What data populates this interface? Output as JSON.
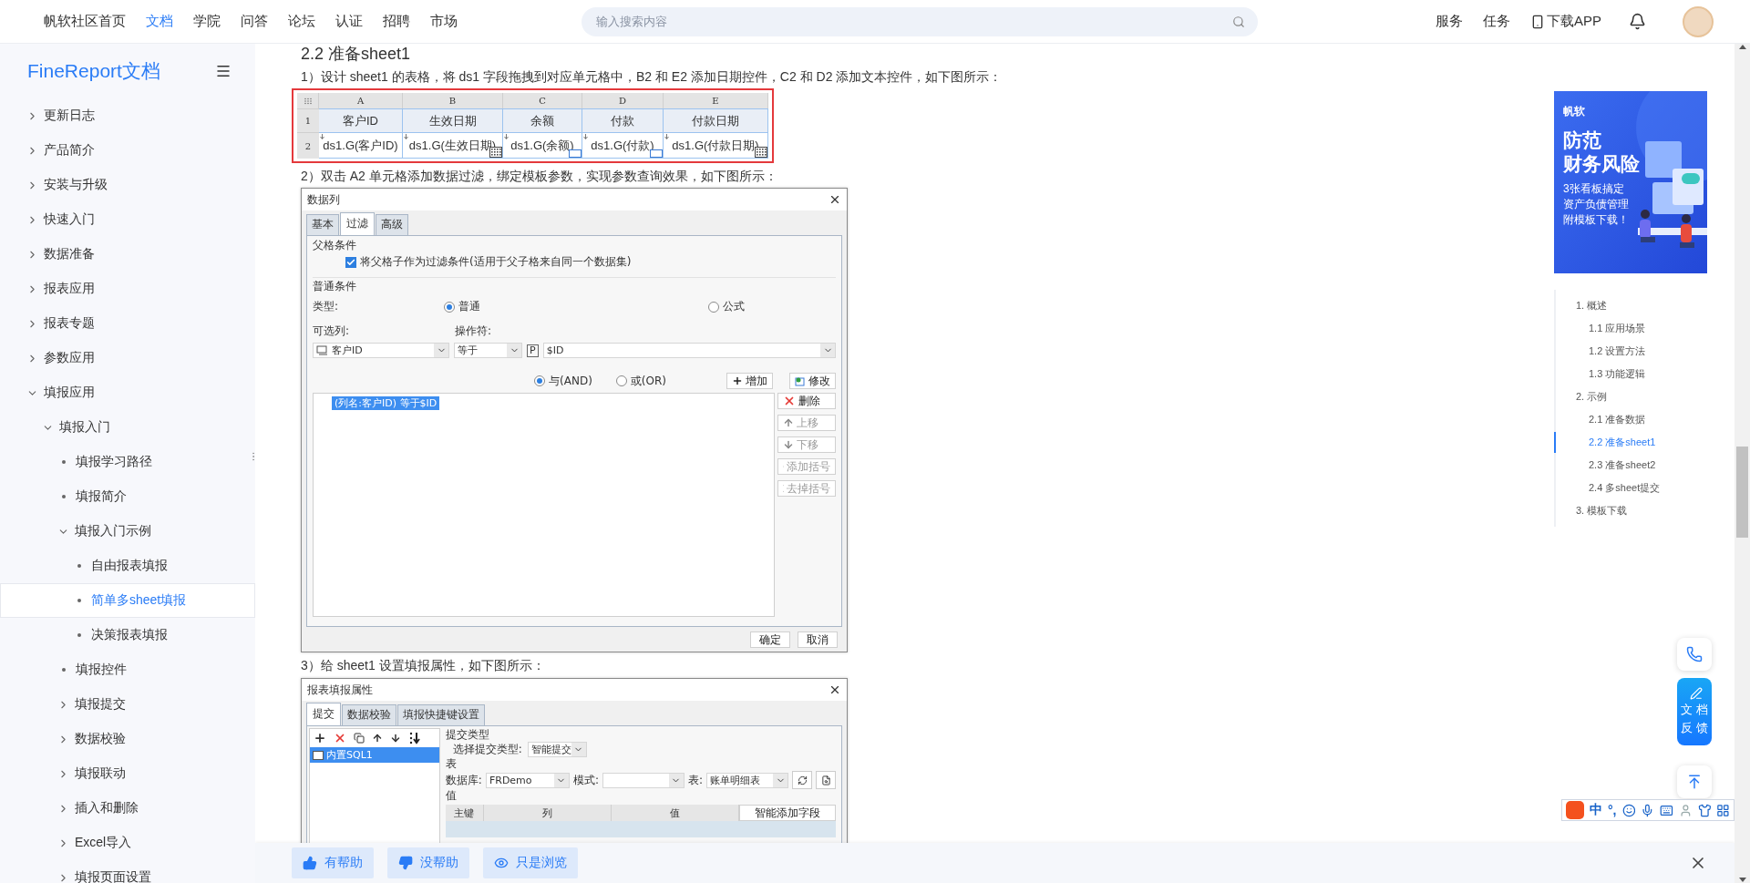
{
  "top_nav": {
    "items": [
      {
        "label": "帆软社区首页",
        "selected": false
      },
      {
        "label": "文档",
        "selected": true
      },
      {
        "label": "学院",
        "selected": false
      },
      {
        "label": "问答",
        "selected": false
      },
      {
        "label": "论坛",
        "selected": false
      },
      {
        "label": "认证",
        "selected": false
      },
      {
        "label": "招聘",
        "selected": false
      },
      {
        "label": "市场",
        "selected": false
      }
    ],
    "search": {
      "placeholder": "输入搜索内容"
    },
    "links": [
      "服务",
      "任务"
    ],
    "download": "下载APP"
  },
  "sidebar": {
    "title": "FineReport文档",
    "items": [
      {
        "label": "更新日志",
        "kind": "folder",
        "expanded": false,
        "selected": false
      },
      {
        "label": "产品简介",
        "kind": "folder",
        "expanded": false,
        "selected": false
      },
      {
        "label": "安装与升级",
        "kind": "folder",
        "expanded": false,
        "selected": false
      },
      {
        "label": "快速入门",
        "kind": "folder",
        "expanded": false,
        "selected": false
      },
      {
        "label": "数据准备",
        "kind": "folder",
        "expanded": false,
        "selected": false
      },
      {
        "label": "报表应用",
        "kind": "folder",
        "expanded": false,
        "selected": false
      },
      {
        "label": "报表专题",
        "kind": "folder",
        "expanded": false,
        "selected": false
      },
      {
        "label": "参数应用",
        "kind": "folder",
        "expanded": false,
        "selected": false
      },
      {
        "label": "填报应用",
        "kind": "folder",
        "expanded": true,
        "selected": false,
        "children": [
          {
            "label": "填报入门",
            "kind": "folder",
            "expanded": true,
            "selected": false,
            "children": [
              {
                "label": "填报学习路径",
                "kind": "page",
                "selected": false
              },
              {
                "label": "填报简介",
                "kind": "page",
                "selected": false
              },
              {
                "label": "填报入门示例",
                "kind": "folder",
                "expanded": true,
                "selected": false,
                "children": [
                  {
                    "label": "自由报表填报",
                    "kind": "page",
                    "selected": false
                  },
                  {
                    "label": "简单多sheet填报",
                    "kind": "page",
                    "selected": true
                  },
                  {
                    "label": "决策报表填报",
                    "kind": "page",
                    "selected": false
                  }
                ]
              },
              {
                "label": "填报控件",
                "kind": "page",
                "selected": false
              },
              {
                "label": "填报提交",
                "kind": "folder",
                "expanded": false,
                "selected": false
              },
              {
                "label": "数据校验",
                "kind": "folder",
                "expanded": false,
                "selected": false
              },
              {
                "label": "填报联动",
                "kind": "folder",
                "expanded": false,
                "selected": false
              },
              {
                "label": "插入和删除",
                "kind": "folder",
                "expanded": false,
                "selected": false
              },
              {
                "label": "Excel导入",
                "kind": "folder",
                "expanded": false,
                "selected": false
              },
              {
                "label": "填报页面设置",
                "kind": "folder",
                "expanded": false,
                "selected": false
              }
            ]
          }
        ]
      }
    ]
  },
  "article": {
    "heading": "2.2 准备sheet1",
    "blocks": [
      {
        "kind": "paragraph",
        "text": "1）设计 sheet1 的表格，将 ds1 字段拖拽到对应单元格中，B2 和 E2 添加日期控件，C2 和 D2 添加文本控件，如下图所示："
      },
      {
        "kind": "sheet",
        "columns": [
          "A",
          "B",
          "C",
          "D",
          "E"
        ],
        "row_numbers": [
          "1",
          "2"
        ],
        "rows": [
          [
            {
              "text": "客户ID"
            },
            {
              "text": "生效日期"
            },
            {
              "text": "余额"
            },
            {
              "text": "付款"
            },
            {
              "text": "付款日期"
            }
          ],
          [
            {
              "text": "ds1.G(客户ID)",
              "kind": "plain"
            },
            {
              "text": "ds1.G(生效日期)",
              "kind": "date"
            },
            {
              "text": "ds1.G(余额)",
              "kind": "text"
            },
            {
              "text": "ds1.G(付款)",
              "kind": "text"
            },
            {
              "text": "ds1.G(付款日期)",
              "kind": "date"
            }
          ]
        ]
      },
      {
        "kind": "paragraph",
        "text": "2）双击 A2 单元格添加数据过滤，绑定模板参数，实现参数查询效果，如下图所示："
      },
      {
        "kind": "filter_dialog",
        "title": "数据列",
        "tabs": [
          {
            "label": "基本",
            "selected": false
          },
          {
            "label": "过滤",
            "selected": true
          },
          {
            "label": "高级",
            "selected": false
          }
        ],
        "parent_legend": "父格条件",
        "parent_checkbox": {
          "label": "将父格子作为过滤条件(适用于父子格来自同一个数据集)",
          "checked": true
        },
        "normal_legend": "普通条件",
        "type_label": "类型:",
        "type_options": [
          {
            "label": "普通",
            "selected": true
          },
          {
            "label": "公式",
            "selected": false
          }
        ],
        "column_label": "可选列:",
        "operator_label": "操作符:",
        "column_value": "客户ID",
        "operator_value": "等于",
        "param_mark": "P",
        "param_value": "$ID",
        "logic_options": [
          {
            "label": "与(AND)",
            "selected": true
          },
          {
            "label": "或(OR)",
            "selected": false
          }
        ],
        "add_button": "增加",
        "edit_button": "修改",
        "conditions": [
          {
            "text": "(列名:客户ID) 等于$ID",
            "selected": true
          }
        ],
        "side_buttons": [
          {
            "label": "删除",
            "kind": "delete",
            "disabled": false
          },
          {
            "label": "上移",
            "kind": "up",
            "disabled": true
          },
          {
            "label": "下移",
            "kind": "down",
            "disabled": true
          },
          {
            "label": "添加括号",
            "kind": "add_paren",
            "disabled": true
          },
          {
            "label": "去掉括号",
            "kind": "remove_paren",
            "disabled": true
          }
        ],
        "footer_buttons": [
          "确定",
          "取消"
        ]
      },
      {
        "kind": "paragraph",
        "text": "3）给 sheet1 设置填报属性，如下图所示："
      },
      {
        "kind": "submit_dialog",
        "title": "报表填报属性",
        "tabs": [
          {
            "label": "提交",
            "selected": true
          },
          {
            "label": "数据校验",
            "selected": false
          },
          {
            "label": "填报快捷键设置",
            "selected": false
          }
        ],
        "tree": [
          {
            "label": "内置SQL1",
            "selected": true
          }
        ],
        "type_legend": "提交类型",
        "type_label": "选择提交类型:",
        "type_value": "智能提交",
        "table_legend": "表",
        "db_label": "数据库:",
        "db_value": "FRDemo",
        "schema_label": "模式:",
        "table_label": "表:",
        "table_value": "账单明细表",
        "value_legend": "值",
        "columns": [
          "主键",
          "列",
          "值"
        ],
        "smart_button": "智能添加字段"
      }
    ]
  },
  "ad": {
    "brand": "帆软",
    "headline": [
      "防范",
      "财务风险"
    ],
    "lines": [
      "3张看板搞定",
      "资产负债管理",
      "附模板下载！"
    ]
  },
  "toc": {
    "items": [
      {
        "label": "1. 概述",
        "selected": false,
        "children": [
          {
            "label": "1.1 应用场景",
            "selected": false
          },
          {
            "label": "1.2 设置方法",
            "selected": false
          },
          {
            "label": "1.3 功能逻辑",
            "selected": false
          }
        ]
      },
      {
        "label": "2. 示例",
        "selected": false,
        "children": [
          {
            "label": "2.1 准备数据",
            "selected": false
          },
          {
            "label": "2.2 准备sheet1",
            "selected": true
          },
          {
            "label": "2.3 准备sheet2",
            "selected": false
          },
          {
            "label": "2.4 多sheet提交",
            "selected": false
          }
        ]
      },
      {
        "label": "3. 模板下载",
        "selected": false
      }
    ]
  },
  "feedback_float": [
    "文档",
    "反馈"
  ],
  "ime": {
    "mode": "中",
    "punct": "°,"
  },
  "help_bar": {
    "buttons": [
      {
        "label": "有帮助",
        "kind": "up"
      },
      {
        "label": "没帮助",
        "kind": "down"
      },
      {
        "label": "只是浏览",
        "kind": "view"
      }
    ]
  }
}
